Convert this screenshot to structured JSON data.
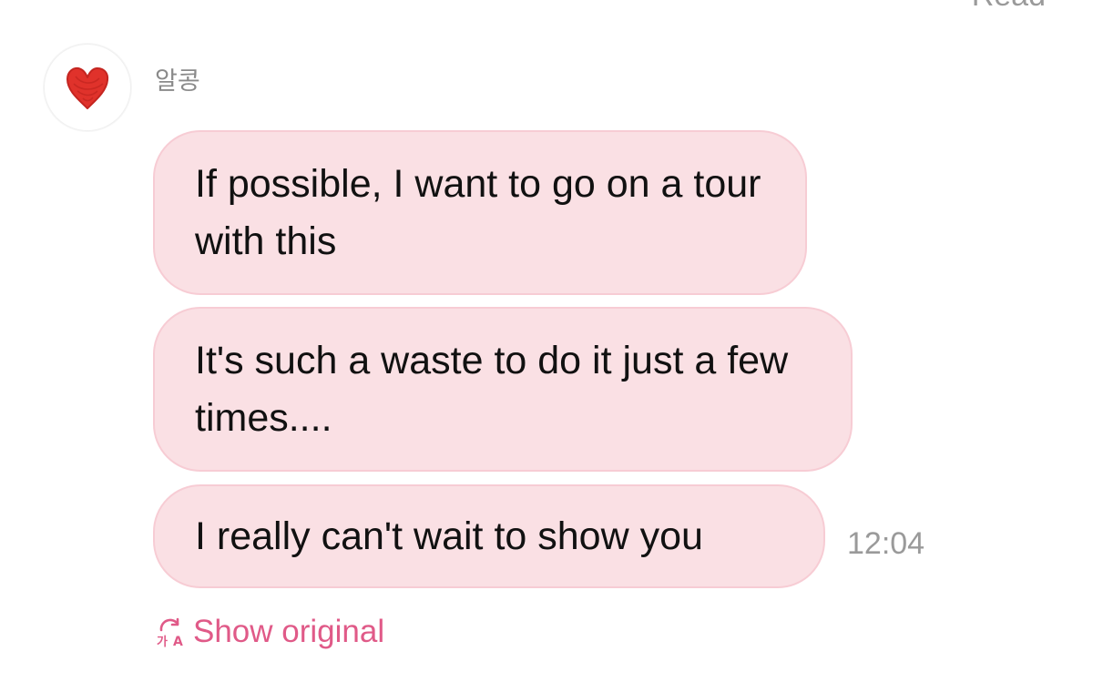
{
  "header": {
    "read_status": "Read"
  },
  "message_group": {
    "sender": {
      "name": "알콩",
      "avatar_icon": "red-heart-icon"
    },
    "messages": [
      {
        "text": "If possible, I want to go on a tour with this"
      },
      {
        "text": "It's such a waste to do it just a few times...."
      },
      {
        "text": "I really can't wait to show you"
      }
    ],
    "timestamp": "12:04",
    "translation_toggle": {
      "icon": "translate-icon",
      "label": "Show original"
    }
  },
  "colors": {
    "bubble_background": "#fae0e4",
    "bubble_border": "#f7ccd4",
    "accent_pink": "#e05a88",
    "meta_gray": "#9a9a9a",
    "heart_red": "#e0322b"
  }
}
